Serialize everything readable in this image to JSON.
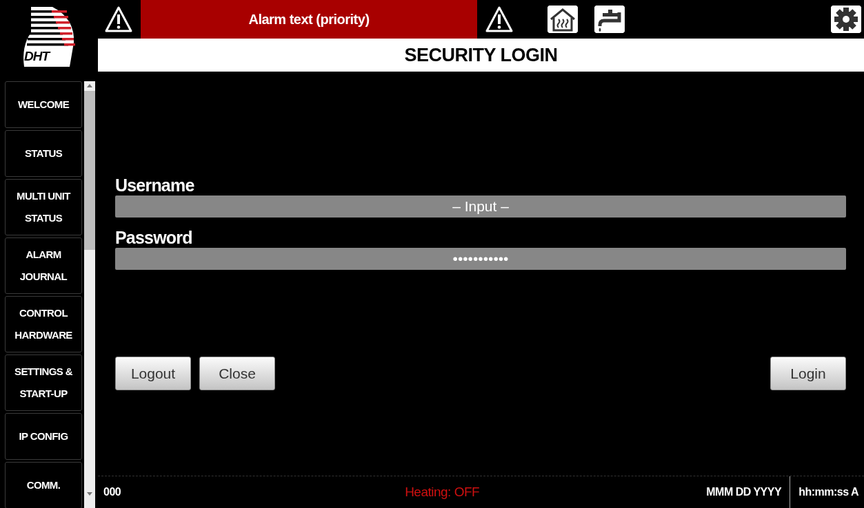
{
  "logo": {
    "text": "DHT"
  },
  "nav": [
    {
      "label": "WELCOME"
    },
    {
      "label": "STATUS"
    },
    {
      "label": "MULTI UNIT STATUS"
    },
    {
      "label": "ALARM JOURNAL"
    },
    {
      "label": "CONTROL HARDWARE"
    },
    {
      "label": "SETTINGS & START-UP"
    },
    {
      "label": "IP CONFIG"
    },
    {
      "label": "COMM."
    }
  ],
  "alarm_banner": {
    "text": "Alarm text (priority)"
  },
  "title": "SECURITY LOGIN",
  "form": {
    "fields": [
      {
        "label": "Username",
        "value": "– Input –"
      },
      {
        "label": "Password",
        "value": "•••••••••••"
      }
    ]
  },
  "buttons_left": [
    {
      "label": "Logout"
    },
    {
      "label": "Close"
    }
  ],
  "buttons_right": [
    {
      "label": "Login"
    }
  ],
  "status_bar": {
    "count": "000",
    "heating": "Heating: OFF",
    "date": "MMM DD YYYY",
    "time": "hh:mm:ss A"
  }
}
